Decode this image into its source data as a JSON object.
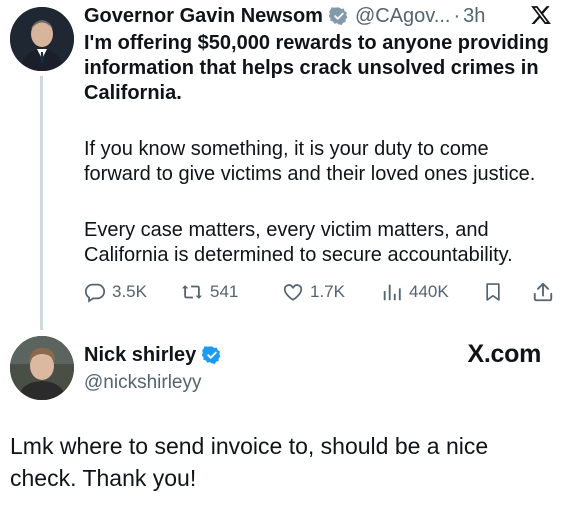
{
  "tweet1": {
    "author_name": "Governor Gavin Newsom",
    "handle": "@CAgov...",
    "dot": "·",
    "time": "3h",
    "headline": "I'm offering $50,000 rewards to anyone providing information that helps crack unsolved crimes in California.",
    "paragraph1": "If you know something, it is your duty to come forward to give victims and their loved ones justice.",
    "paragraph2": "Every case matters, every victim matters, and California is determined to secure accountability.",
    "stats": {
      "replies": "3.5K",
      "reposts": "541",
      "likes": "1.7K",
      "views": "440K"
    }
  },
  "tweet2": {
    "author_name": "Nick shirley",
    "handle": "@nickshirleyy",
    "site": "X.com",
    "text": "Lmk where to send invoice to, should be a nice check. Thank you!"
  },
  "colors": {
    "text": "#0f1419",
    "muted": "#536471",
    "verified": "#1d9bf0",
    "thread_line": "#cfd9de"
  },
  "icons": [
    "x-logo-icon",
    "verified-badge-icon",
    "reply-icon",
    "repost-icon",
    "like-icon",
    "views-icon",
    "bookmark-icon",
    "share-icon"
  ]
}
